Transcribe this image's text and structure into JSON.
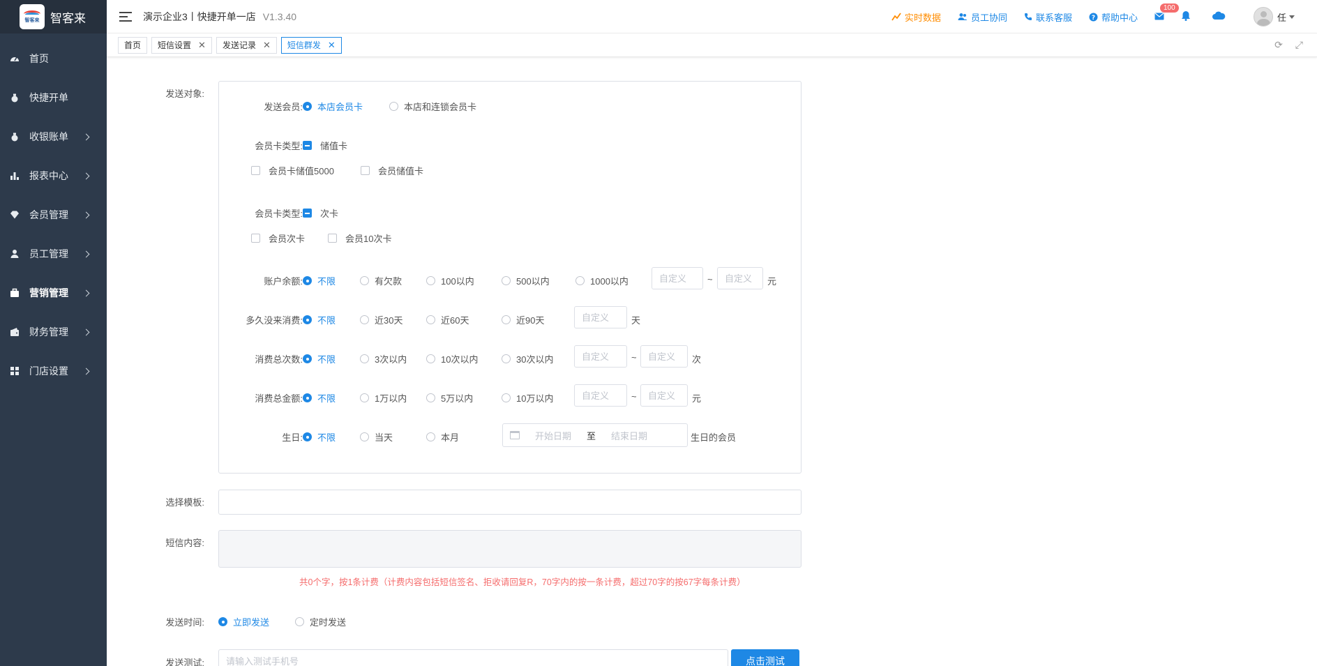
{
  "app": {
    "logo_text": "智客来",
    "logo_badge_text": "智客来"
  },
  "header": {
    "title": "演示企业3丨快捷开单一店",
    "version": "V1.3.40",
    "links": {
      "realtime": "实时数据",
      "staff_collab": "员工协同",
      "support": "联系客服",
      "help": "帮助中心"
    },
    "mail_badge": "100",
    "user_name": "任"
  },
  "sidebar": {
    "items": [
      {
        "label": "首页"
      },
      {
        "label": "快捷开单"
      },
      {
        "label": "收银账单"
      },
      {
        "label": "报表中心"
      },
      {
        "label": "会员管理"
      },
      {
        "label": "员工管理"
      },
      {
        "label": "营销管理"
      },
      {
        "label": "财务管理"
      },
      {
        "label": "门店设置"
      }
    ]
  },
  "tabs": [
    {
      "label": "首页"
    },
    {
      "label": "短信设置"
    },
    {
      "label": "发送记录"
    },
    {
      "label": "短信群发"
    }
  ],
  "form": {
    "target_label": "发送对象:",
    "send_member": {
      "label": "发送会员:",
      "opt_local": "本店会员卡",
      "opt_chain": "本店和连锁会员卡"
    },
    "card_type_1": {
      "label": "会员卡类型:",
      "group": "储值卡",
      "opts": [
        "会员卡储值5000",
        "会员储值卡"
      ]
    },
    "card_type_2": {
      "label": "会员卡类型:",
      "group": "次卡",
      "opts": [
        "会员次卡",
        "会员10次卡"
      ]
    },
    "balance": {
      "label": "账户余额:",
      "opts": [
        "不限",
        "有欠款",
        "100以内",
        "500以内",
        "1000以内"
      ],
      "custom_ph": "自定义",
      "tilde": "~",
      "unit": "元"
    },
    "inactive": {
      "label": "多久没来消费:",
      "opts": [
        "不限",
        "近30天",
        "近60天",
        "近90天"
      ],
      "custom_ph": "自定义",
      "unit": "天"
    },
    "visits": {
      "label": "消费总次数:",
      "opts": [
        "不限",
        "3次以内",
        "10次以内",
        "30次以内"
      ],
      "custom_ph": "自定义",
      "tilde": "~",
      "unit": "次"
    },
    "amount": {
      "label": "消费总金额:",
      "opts": [
        "不限",
        "1万以内",
        "5万以内",
        "10万以内"
      ],
      "custom_ph": "自定义",
      "tilde": "~",
      "unit": "元"
    },
    "birthday": {
      "label": "生日:",
      "opts": [
        "不限",
        "当天",
        "本月"
      ],
      "start_ph": "开始日期",
      "to": "至",
      "end_ph": "结束日期",
      "suffix": "生日的会员"
    },
    "template_label": "选择模板:",
    "content_label": "短信内容:",
    "content_tip": "共0个字，按1条计费（计费内容包括短信签名、拒收请回复R，70字内的按一条计费，超过70字的按67字每条计费）",
    "send_time": {
      "label": "发送时间:",
      "opt_now": "立即发送",
      "opt_timed": "定时发送"
    },
    "test": {
      "label": "发送测试:",
      "phone_ph": "请输入测试手机号",
      "button": "点击测试"
    }
  },
  "colors": {
    "accent": "#1e88e5",
    "sidebar_bg": "#2d3a4b",
    "warning": "#f56c6c",
    "orange": "#ff8c00"
  }
}
